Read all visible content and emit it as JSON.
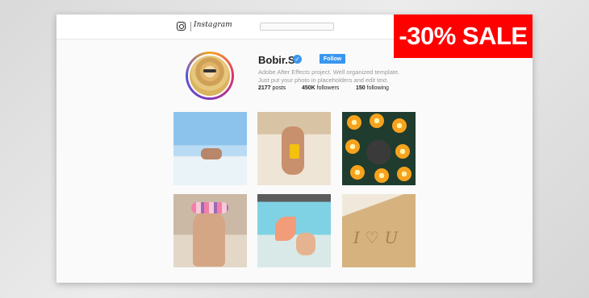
{
  "topbar": {
    "app_name": "Instagram",
    "search_placeholder": ""
  },
  "promo": {
    "label": "-30% SALE",
    "color": "#ff0000"
  },
  "profile": {
    "username": "Bobir.S",
    "verified_icon": "check-icon",
    "follow_label": "Follow",
    "bio_line1": "Adobe After Effects project. Well organized template.",
    "bio_line2": "Just put your photo in placeholders and edit text.",
    "posts_count": "2177",
    "posts_label": "posts",
    "followers_count": "450K",
    "followers_label": "followers",
    "following_count": "150",
    "following_label": "following"
  },
  "colors": {
    "accent": "#3897f0",
    "sale": "#ff0000"
  },
  "grid": {
    "photos": [
      "beach-couple",
      "girl-with-drink",
      "oranges-water",
      "flower-crown-girl",
      "mermaid-tail",
      "sand-writing"
    ]
  }
}
